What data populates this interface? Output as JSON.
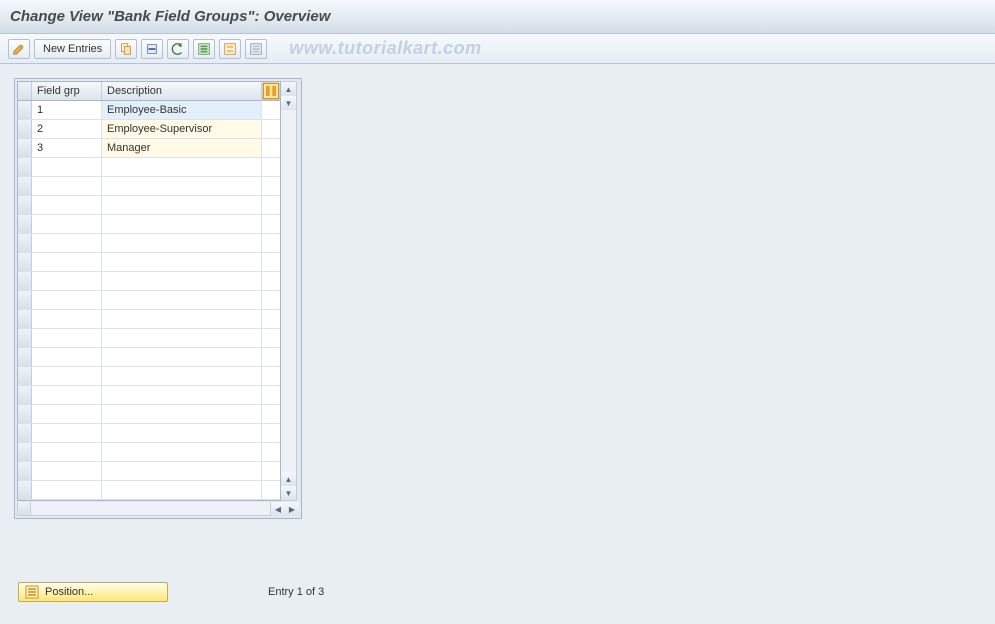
{
  "title": "Change View \"Bank Field Groups\": Overview",
  "toolbar": {
    "new_entries_label": "New Entries"
  },
  "watermark": "www.tutorialkart.com",
  "table": {
    "columns": {
      "field_grp": "Field grp",
      "description": "Description"
    },
    "rows": [
      {
        "field_grp": "1",
        "description": "Employee-Basic"
      },
      {
        "field_grp": "2",
        "description": "Employee-Supervisor"
      },
      {
        "field_grp": "3",
        "description": "Manager"
      }
    ],
    "empty_row_count": 18
  },
  "footer": {
    "position_label": "Position...",
    "entry_label": "Entry 1 of 3"
  }
}
